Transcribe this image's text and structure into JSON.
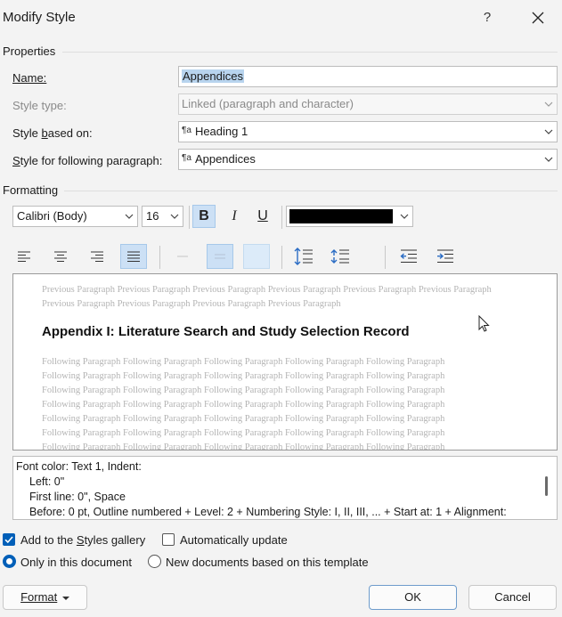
{
  "window": {
    "title": "Modify Style",
    "help_label": "?"
  },
  "properties": {
    "section_label": "Properties",
    "name_label": "Name:",
    "name_value": "Appendices",
    "style_type_label": "Style type:",
    "style_type_value": "Linked (paragraph and character)",
    "based_on_label_pre": "Style ",
    "based_on_label_u": "b",
    "based_on_label_post": "ased on:",
    "based_on_value": "Heading 1",
    "following_label_u": "S",
    "following_label_post": "tyle for following paragraph:",
    "following_value": "Appendices",
    "para_icon": "¶a"
  },
  "formatting": {
    "section_label": "Formatting",
    "font_name": "Calibri (Body)",
    "font_size": "16",
    "bold_label": "B",
    "italic_label": "I",
    "underline_label": "U",
    "font_color": "#000000"
  },
  "preview": {
    "previous_text": "Previous Paragraph Previous Paragraph Previous Paragraph Previous Paragraph Previous Paragraph Previous Paragraph Previous Paragraph Previous Paragraph Previous Paragraph Previous Paragraph",
    "heading": "Appendix I:  Literature Search and Study Selection Record",
    "following_line": "Following Paragraph Following Paragraph Following Paragraph Following Paragraph Following Paragraph"
  },
  "description": {
    "line1": "Font color: Text 1, Indent:",
    "line2": "Left:  0\"",
    "line3": "First line:  0\", Space",
    "line4": "Before:  0 pt, Outline numbered + Level: 2 + Numbering Style: I, II, III, ... + Start at: 1 + Alignment:"
  },
  "options": {
    "add_gallery_pre": "Add to the ",
    "add_gallery_u": "S",
    "add_gallery_post": "tyles gallery",
    "add_gallery_checked": true,
    "auto_update_label": "Automatically update",
    "auto_update_checked": false,
    "only_doc_label": "Only in this document",
    "only_doc_selected": true,
    "new_docs_label": "New documents based on this template",
    "new_docs_selected": false
  },
  "buttons": {
    "format_label": "Format",
    "ok_label": "OK",
    "cancel_label": "Cancel"
  },
  "colors": {
    "accent": "#005fb8",
    "selection": "#b8d4ee",
    "pressed_button": "#cce0f5"
  }
}
